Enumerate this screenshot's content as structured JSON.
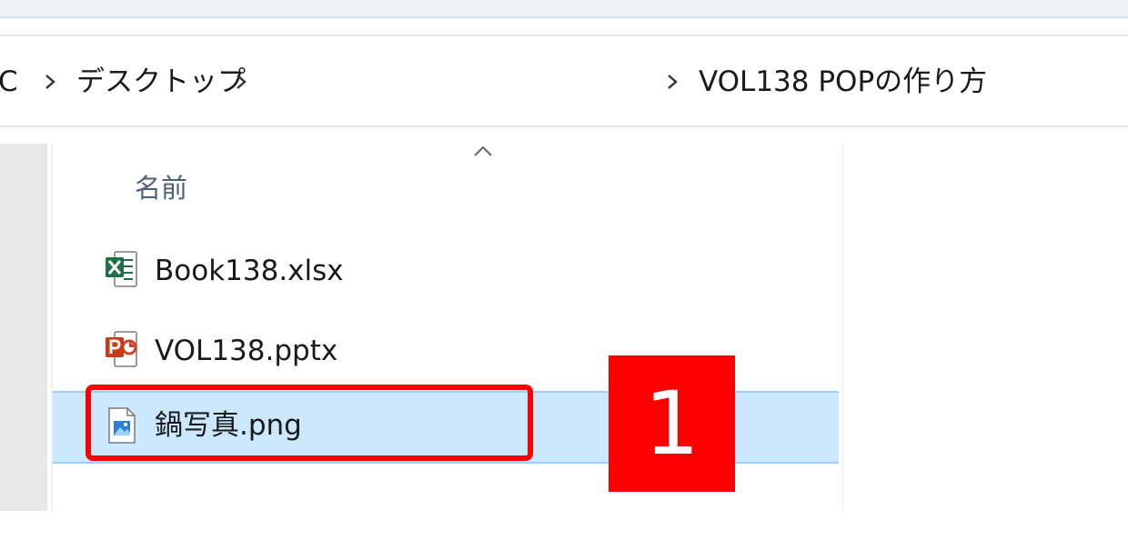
{
  "breadcrumb": {
    "items": [
      "C",
      "デスクトップ",
      "VOL138 POPの作り方"
    ],
    "separator_icon": "chevron-right-icon"
  },
  "file_list": {
    "sort_indicator_icon": "chevron-up-icon",
    "column_header": "名前",
    "files": [
      {
        "name": "Book138.xlsx",
        "icon": "excel-file-icon",
        "selected": false
      },
      {
        "name": "VOL138.pptx",
        "icon": "powerpoint-file-icon",
        "selected": false
      },
      {
        "name": "鍋写真.png",
        "icon": "image-file-icon",
        "selected": true
      }
    ]
  },
  "annotation": {
    "step_number": "1",
    "color": "#ff0000"
  },
  "colors": {
    "selection_bg": "#cce8ff",
    "selection_border": "#99d1ff",
    "header_text": "#4c607a"
  }
}
